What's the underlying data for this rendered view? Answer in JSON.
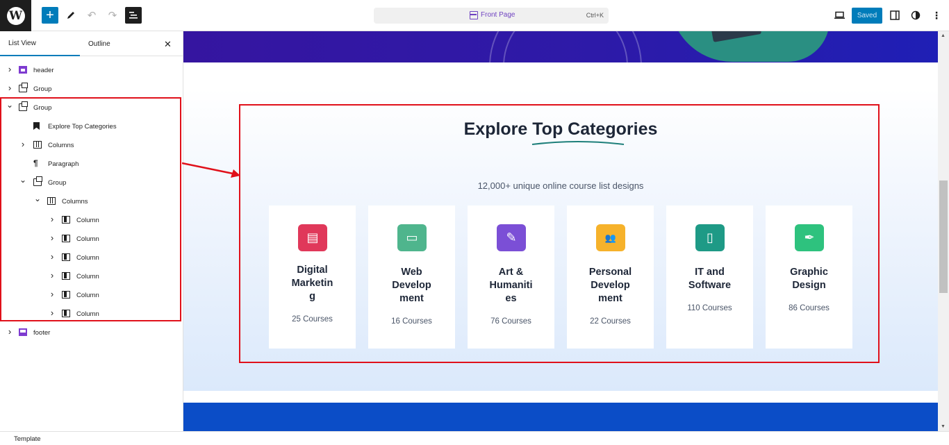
{
  "topbar": {
    "document_title": "Front Page",
    "shortcut": "Ctrl+K",
    "saved_label": "Saved"
  },
  "sidebar": {
    "tabs": [
      "List View",
      "Outline"
    ],
    "tree": [
      {
        "label": "header",
        "icon": "template-part-icon",
        "chevron": "right"
      },
      {
        "label": "Group",
        "icon": "group-icon",
        "chevron": "right"
      },
      {
        "label": "Group",
        "icon": "group-icon",
        "chevron": "down"
      },
      {
        "label": "Explore Top Categories",
        "icon": "heading-bookmark-icon",
        "chevron": ""
      },
      {
        "label": "Columns",
        "icon": "columns-icon",
        "chevron": "right"
      },
      {
        "label": "Paragraph",
        "icon": "paragraph-icon",
        "chevron": ""
      },
      {
        "label": "Group",
        "icon": "group-icon",
        "chevron": "down"
      },
      {
        "label": "Columns",
        "icon": "columns-icon",
        "chevron": "down"
      },
      {
        "label": "Column",
        "icon": "column-icon",
        "chevron": "right"
      },
      {
        "label": "Column",
        "icon": "column-icon",
        "chevron": "right"
      },
      {
        "label": "Column",
        "icon": "column-icon",
        "chevron": "right"
      },
      {
        "label": "Column",
        "icon": "column-icon",
        "chevron": "right"
      },
      {
        "label": "Column",
        "icon": "column-icon",
        "chevron": "right"
      },
      {
        "label": "Column",
        "icon": "column-icon",
        "chevron": "right"
      },
      {
        "label": "footer",
        "icon": "template-part-icon",
        "chevron": "right"
      }
    ]
  },
  "statusbar": {
    "label": "Template"
  },
  "content": {
    "title_plain": "Explore ",
    "title_emph": "Top Categories",
    "subtitle": "12,000+ unique online course list designs",
    "categories": [
      {
        "title_lines": [
          "Digital",
          "Marketin",
          "g"
        ],
        "count": "25 Courses",
        "icon": "store-icon",
        "color": "#e0385a"
      },
      {
        "title_lines": [
          "Web",
          "Develop",
          "ment"
        ],
        "count": "16 Courses",
        "icon": "desktop-icon",
        "color": "#4fb58d"
      },
      {
        "title_lines": [
          "Art &",
          "Humaniti",
          "es"
        ],
        "count": "76 Courses",
        "icon": "pencil-icon",
        "color": "#7b4fd6"
      },
      {
        "title_lines": [
          "Personal",
          "Develop",
          "ment"
        ],
        "count": "22 Courses",
        "icon": "users-icon",
        "color": "#f6b22b"
      },
      {
        "title_lines": [
          "IT and",
          "Software"
        ],
        "count": "110 Courses",
        "icon": "mobile-icon",
        "color": "#1e9a86"
      },
      {
        "title_lines": [
          "Graphic",
          "Design"
        ],
        "count": "86 Courses",
        "icon": "pen-nib-icon",
        "color": "#2ec27e"
      }
    ]
  },
  "colors": {
    "accent": "#007cba",
    "selection": "#e0101a",
    "heading": "#1d2637",
    "underline": "#1e7f7a"
  }
}
